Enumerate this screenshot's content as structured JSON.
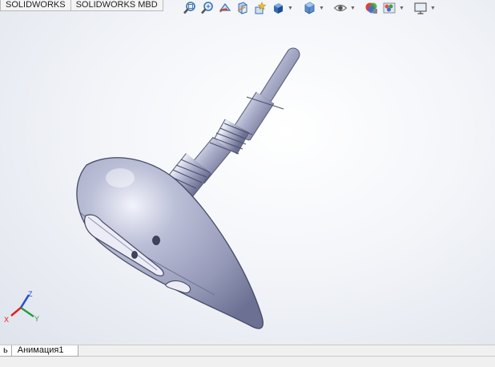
{
  "command_tabs": [
    "SOLIDWORKS",
    "SOLIDWORKS MBD"
  ],
  "view_toolbar": [
    {
      "icon": "zoom-to-fit-icon"
    },
    {
      "icon": "zoom-to-area-icon"
    },
    {
      "icon": "previous-view-icon"
    },
    {
      "icon": "section-view-icon"
    },
    {
      "icon": "dynamic-annotation-icon"
    },
    {
      "icon": "view-orientation-icon",
      "dropdown": true
    },
    {
      "icon": "display-style-icon",
      "dropdown": true
    },
    {
      "icon": "hide-show-items-icon",
      "dropdown": true
    },
    {
      "icon": "edit-appearance-icon"
    },
    {
      "icon": "apply-scene-icon",
      "dropdown": true
    },
    {
      "icon": "view-settings-icon",
      "dropdown": true
    }
  ],
  "triad": {
    "x_label": "X",
    "y_label": "Y",
    "z_label": "Z",
    "x_color": "#e02020",
    "y_color": "#20a040",
    "z_color": "#2050d0"
  },
  "bottom_tabs": {
    "first": "ь",
    "animation": "Анимация1"
  },
  "colors": {
    "part": "#a6aac4",
    "accent": "#2f6db3"
  }
}
